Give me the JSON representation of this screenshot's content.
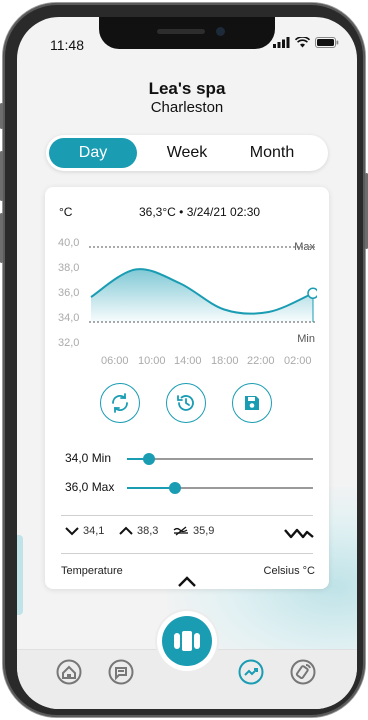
{
  "status_bar": {
    "time": "11:48"
  },
  "header": {
    "title": "Lea's spa",
    "subtitle": "Charleston"
  },
  "tabs": [
    {
      "label": "Day",
      "active": true
    },
    {
      "label": "Week",
      "active": false
    },
    {
      "label": "Month",
      "active": false
    }
  ],
  "chart": {
    "unit": "°C",
    "readout": "36,3°C • 3/24/21 02:30",
    "max_label": "Max",
    "min_label": "Min",
    "y_ticks": [
      "40,0",
      "38,0",
      "36,0",
      "34,0",
      "32,0"
    ],
    "x_ticks": [
      "06:00",
      "10:00",
      "14:00",
      "18:00",
      "22:00",
      "02:00"
    ]
  },
  "chart_data": {
    "type": "area",
    "x": [
      "06:00",
      "10:00",
      "14:00",
      "18:00",
      "22:00",
      "02:00"
    ],
    "values": [
      36.0,
      38.2,
      37.1,
      35.0,
      34.8,
      36.3
    ],
    "ylim": [
      32.0,
      40.0
    ],
    "thresholds": {
      "min": 34.0,
      "max": 40.0
    },
    "series_color": "#1a9cb3"
  },
  "controls": {
    "sync_icon": "sync-icon",
    "history_icon": "history-icon",
    "save_icon": "save-icon"
  },
  "sliders": {
    "min": {
      "label": "34,0 Min",
      "fraction": 0.12
    },
    "max": {
      "label": "36,0 Max",
      "fraction": 0.26
    }
  },
  "stats": {
    "low": "34,1",
    "high": "38,3",
    "avg": "35,9"
  },
  "footer": {
    "left": "Temperature",
    "right": "Celsius °C"
  },
  "nav": {
    "items": [
      "home-icon",
      "chat-icon",
      "pool-icon",
      "analytics-icon",
      "remote-icon"
    ],
    "active": "analytics-icon"
  },
  "colors": {
    "accent": "#1a9cb3",
    "background": "#f3f3f3"
  }
}
